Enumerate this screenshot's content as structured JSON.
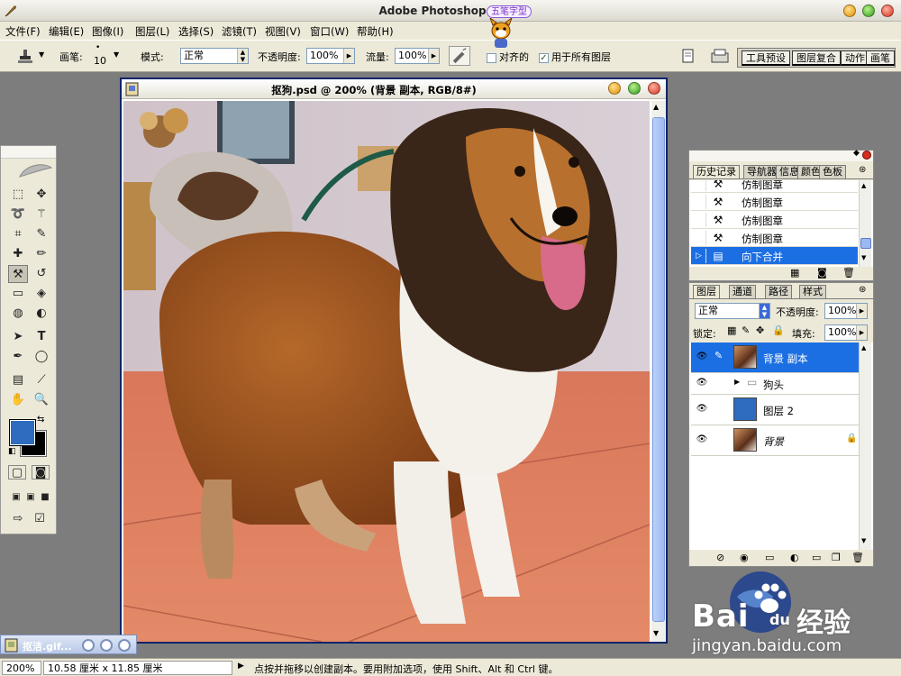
{
  "window": {
    "title": "Adobe Photoshop",
    "ime_badge": "五笔字型"
  },
  "menubar": {
    "items": [
      "文件(F)",
      "编辑(E)",
      "图像(I)",
      "图层(L)",
      "选择(S)",
      "滤镜(T)",
      "视图(V)",
      "窗口(W)",
      "帮助(H)"
    ]
  },
  "options": {
    "brush_label": "画笔:",
    "brush_size": "10",
    "mode_label": "模式:",
    "mode_value": "正常",
    "opacity_label": "不透明度:",
    "opacity_value": "100%",
    "flow_label": "流量:",
    "flow_value": "100%",
    "aligned_label": "对齐的",
    "aligned_checked": false,
    "all_layers_label": "用于所有图层",
    "all_layers_checked": true,
    "well_tabs": [
      "工具预设",
      "图层复合",
      "动作",
      "画笔"
    ]
  },
  "document": {
    "title": "抠狗.psd @ 200% (背景 副本, RGB/8#)"
  },
  "history": {
    "tabs": [
      "历史记录",
      "导航器",
      "信息",
      "颜色",
      "色板"
    ],
    "items": [
      {
        "label": "仿制图章",
        "icon": "stamp-icon",
        "selected": false
      },
      {
        "label": "仿制图章",
        "icon": "stamp-icon",
        "selected": false
      },
      {
        "label": "仿制图章",
        "icon": "stamp-icon",
        "selected": false
      },
      {
        "label": "仿制图章",
        "icon": "stamp-icon",
        "selected": false
      },
      {
        "label": "向下合并",
        "icon": "merge-icon",
        "selected": true
      }
    ]
  },
  "layers": {
    "tabs": [
      "图层",
      "通道",
      "路径",
      "样式"
    ],
    "blend_mode": "正常",
    "opacity_label": "不透明度:",
    "opacity_value": "100%",
    "lock_label": "锁定:",
    "fill_label": "填充:",
    "fill_value": "100%",
    "items": [
      {
        "name": "背景 副本",
        "type": "image",
        "visible": true,
        "selected": true
      },
      {
        "name": "狗头",
        "type": "group",
        "visible": true,
        "selected": false
      },
      {
        "name": "图层 2",
        "type": "fill",
        "visible": true,
        "selected": false,
        "color": "#2f6bbf"
      },
      {
        "name": "背景",
        "type": "image",
        "visible": true,
        "selected": false,
        "locked": true
      }
    ]
  },
  "colors": {
    "foreground": "#2f6bbf",
    "background": "#000000",
    "selection": "#1c6fe3"
  },
  "minimized_doc": {
    "title": "抠洁.gif..."
  },
  "status": {
    "zoom": "200%",
    "doc_size": "10.58 厘米 x 11.85 厘米",
    "hint": "点按并拖移以创建副本。要用附加选项，使用 Shift、Alt 和 Ctrl 键。"
  },
  "watermark": {
    "brand": "Bai",
    "brand2": "du",
    "brand3": "经验",
    "url": "jingyan.baidu.com"
  }
}
